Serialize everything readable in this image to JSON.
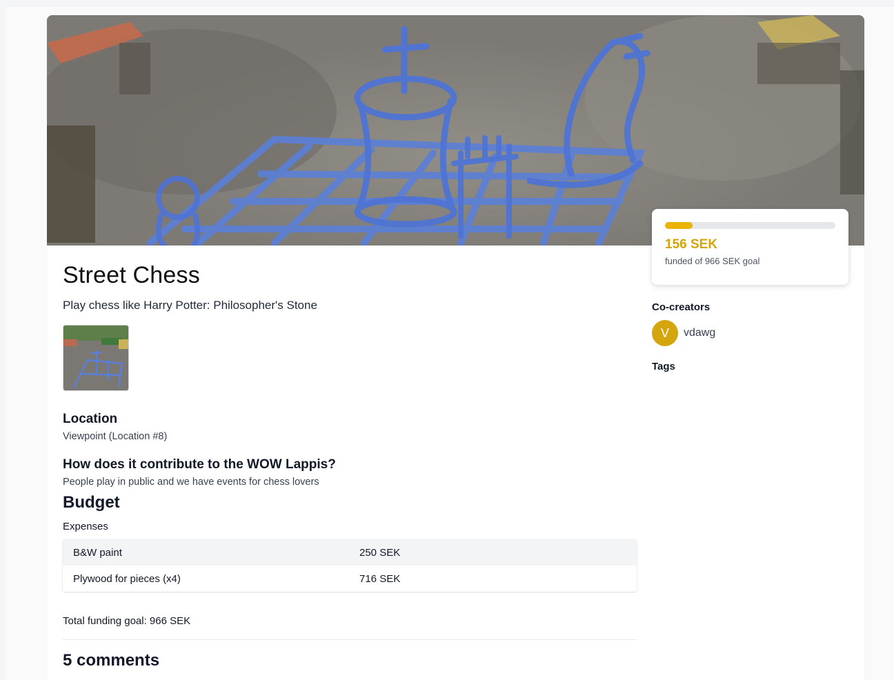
{
  "project": {
    "title": "Street Chess",
    "subtitle": "Play chess like Harry Potter: Philosopher's Stone"
  },
  "location": {
    "heading": "Location",
    "value": "Viewpoint (Location #8)"
  },
  "contribution": {
    "heading": "How does it contribute to the WOW Lappis?",
    "value": "People play in public and we have events for chess lovers"
  },
  "budget": {
    "heading": "Budget",
    "expenses_heading": "Expenses",
    "expenses": [
      {
        "name": "B&W paint",
        "amount": "250 SEK"
      },
      {
        "name": "Plywood for pieces (x4)",
        "amount": "716 SEK"
      }
    ],
    "total_label": "Total funding goal: 966 SEK"
  },
  "funding": {
    "amount": "156 SEK",
    "goal_text": "funded of 966 SEK goal",
    "progress_fraction": 0.1615,
    "accent_color": "#eab308"
  },
  "cocreators": {
    "heading": "Co-creators",
    "items": [
      {
        "initial": "V",
        "name": "vdawg"
      }
    ]
  },
  "tags": {
    "heading": "Tags"
  },
  "comments": {
    "heading": "5 comments"
  }
}
